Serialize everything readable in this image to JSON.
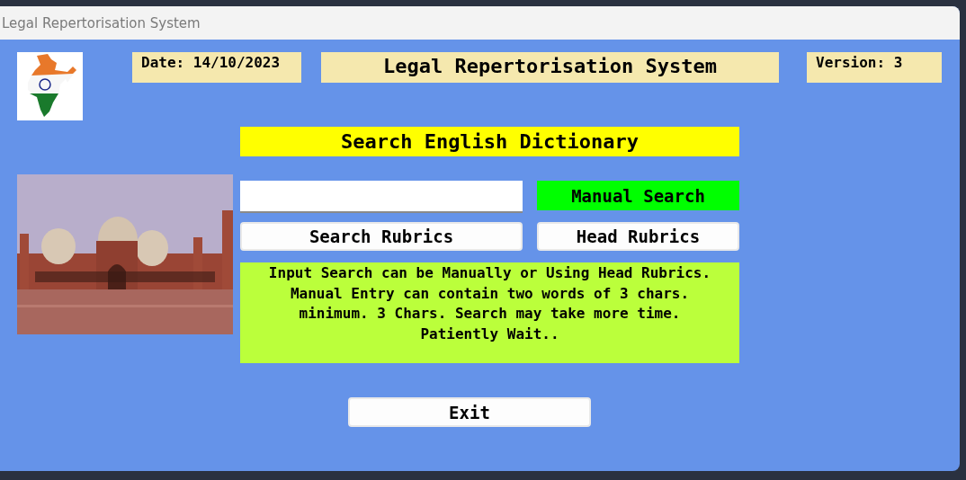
{
  "window": {
    "title": "Legal Repertorisation System"
  },
  "header": {
    "date": "Date: 14/10/2023",
    "title": "Legal Repertorisation System",
    "version": "Version: 3"
  },
  "heading": "Search English Dictionary",
  "manual_search": "Manual Search",
  "buttons": [
    "Search Rubrics",
    "Head Rubrics"
  ],
  "info": "Input Search can be Manually or Using Head Rubrics.\nManual Entry can contain two words of 3 chars.\nminimum. 3 Chars. Search may take more time.\nPatiently Wait..",
  "exit": "Exit"
}
